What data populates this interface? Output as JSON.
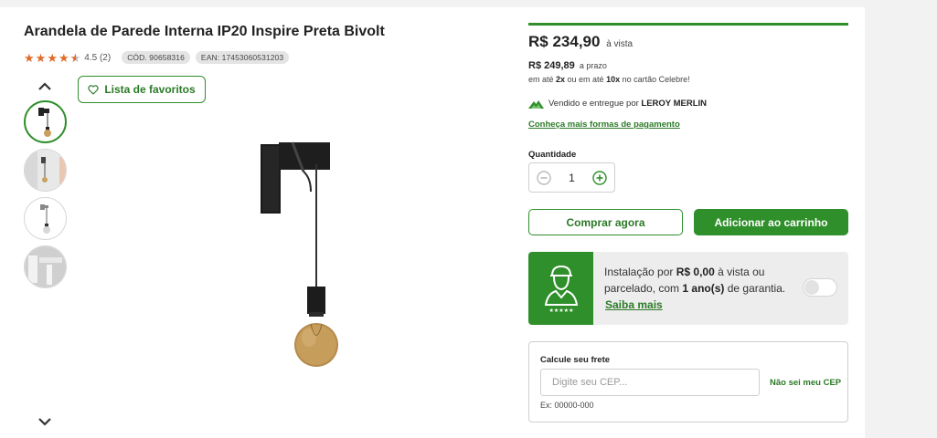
{
  "product": {
    "title": "Arandela de Parede Interna IP20 Inspire Preta Bivolt",
    "rating_text": "4.5 (2)",
    "rating": 4.5,
    "rating_max": 5,
    "cod": "CÓD. 90658316",
    "ean": "EAN: 17453060531203"
  },
  "gallery": {
    "favorites_label": "Lista de favoritos",
    "thumbnail_count": 4,
    "active_thumbnail": 1
  },
  "pricing": {
    "price": "R$ 234,90",
    "price_suffix": "à vista",
    "price_prazo": "R$ 249,89",
    "price_prazo_suffix": "a prazo",
    "installments_prefix": "em até ",
    "installments_a": "2x",
    "installments_mid": " ou em até ",
    "installments_b": "10x",
    "installments_suffix": " no cartão Celebre!",
    "seller_prefix": "Vendido e entregue por ",
    "seller_name": "LEROY MERLIN",
    "payment_link": "Conheça mais formas de pagamento"
  },
  "quantity": {
    "label": "Quantidade",
    "value": "1"
  },
  "actions": {
    "buy_now": "Comprar agora",
    "add_to_cart": "Adicionar ao carrinho"
  },
  "installation": {
    "text_prefix": "Instalação por ",
    "price": "R$ 0,00",
    "text_mid": " à vista ou parcelado, com ",
    "warranty": "1 ano(s)",
    "text_suffix": " de garantia.",
    "link": "Saiba mais",
    "toggle_on": false
  },
  "shipping": {
    "label": "Calcule seu frete",
    "placeholder": "Digite seu CEP...",
    "unknown_cep_link": "Não sei meu CEP",
    "example": "Ex: 00000-000"
  },
  "colors": {
    "brand_green": "#2f8f2b",
    "star_orange": "#e06b2a"
  }
}
